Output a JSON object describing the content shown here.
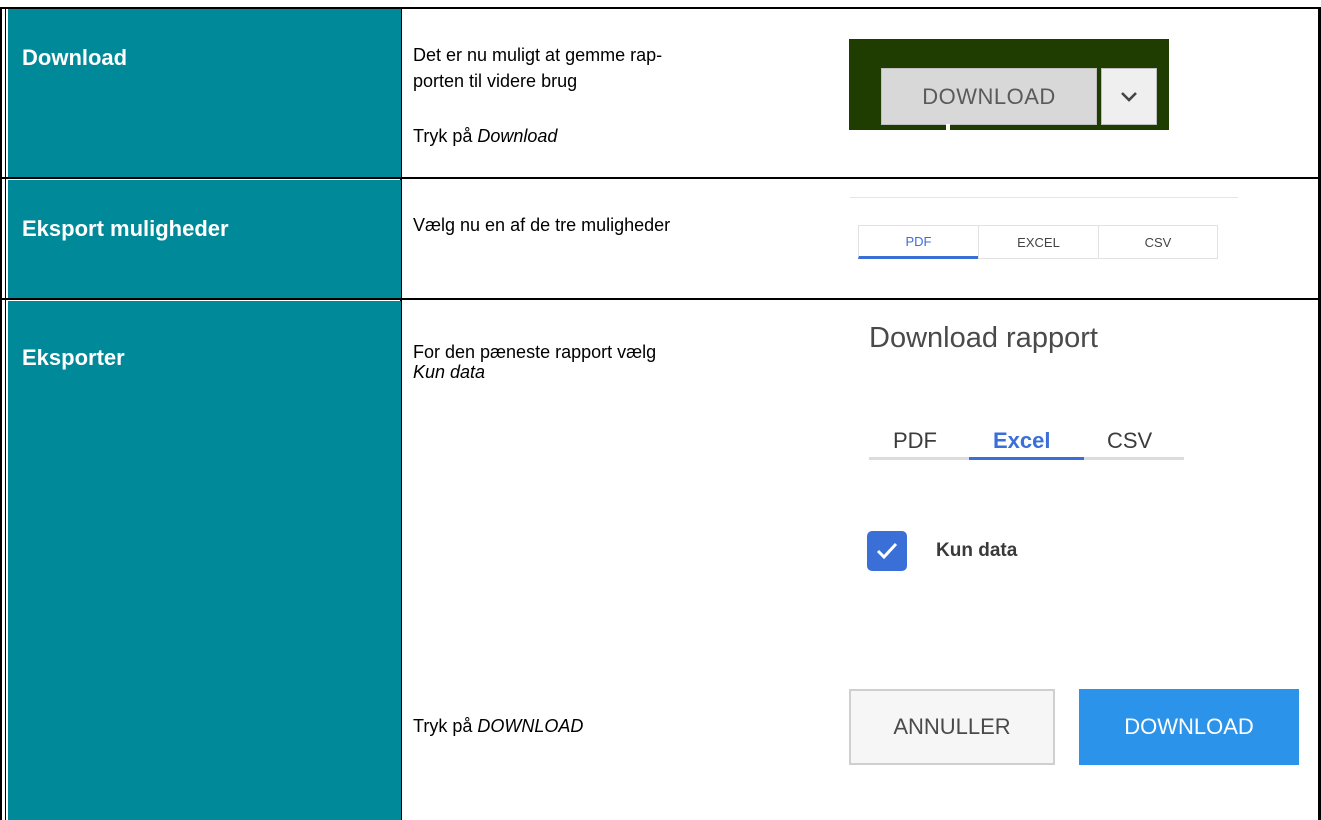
{
  "rows": [
    {
      "heading": "Download",
      "text_lines": [
        "Det er nu muligt at gemme rap-",
        "porten til videre  brug"
      ],
      "instruction_prefix": "Tryk på ",
      "instruction_emph": "Download"
    },
    {
      "heading": "Eksport muligheder",
      "text": "Vælg nu en af de tre muligheder"
    },
    {
      "heading": "Eksporter",
      "text_line1": "For den pæneste rapport  vælg",
      "text_emph": "Kun data",
      "instruction_prefix": "Tryk på ",
      "instruction_emph": "DOWNLOAD"
    }
  ],
  "download_widget": {
    "button_label": "DOWNLOAD",
    "caret_icon": "chevron-down-icon"
  },
  "export_tabs": [
    "PDF",
    "EXCEL",
    "CSV"
  ],
  "export_tabs_active": "PDF",
  "dialog": {
    "title": "Download rapport",
    "tabs": [
      "PDF",
      "Excel",
      "CSV"
    ],
    "active_tab": "Excel",
    "checkbox_label": "Kun data",
    "checkbox_checked": true,
    "cancel_label": "ANNULLER",
    "download_label": "DOWNLOAD"
  },
  "colors": {
    "teal": "#008998",
    "dark_green": "#1f3d00",
    "accent_blue": "#3a6fd8",
    "button_blue": "#2c93ea"
  }
}
